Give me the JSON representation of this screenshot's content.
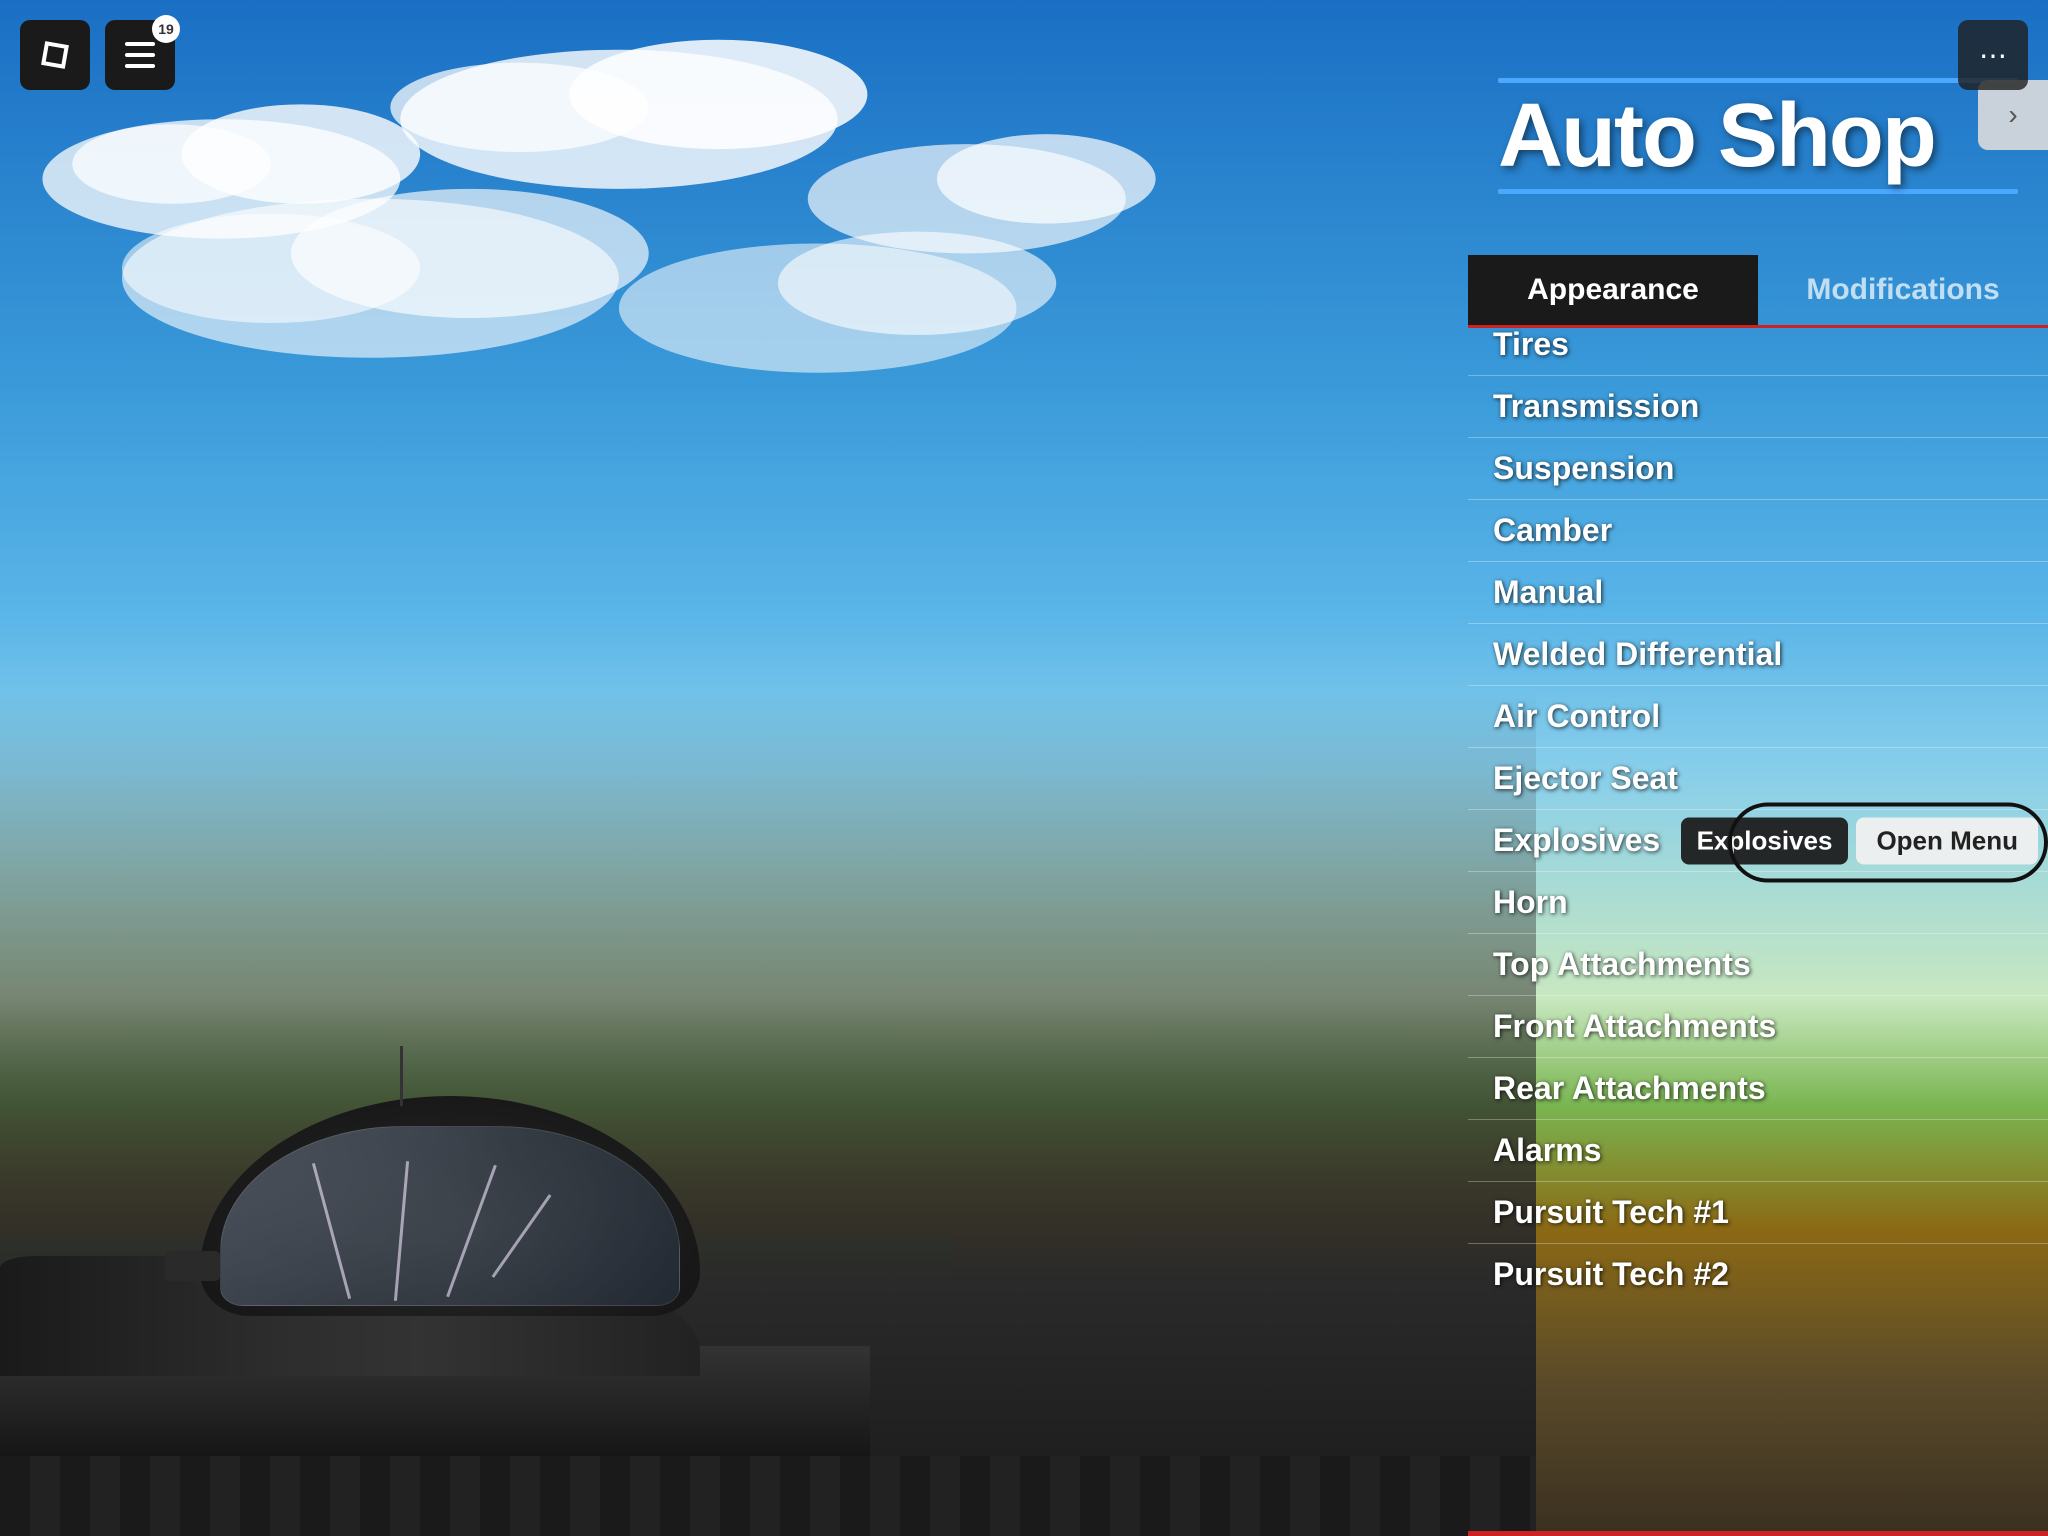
{
  "game": {
    "bg_sky_color_top": "#1a6fc4",
    "bg_sky_color_bottom": "#87ceeb"
  },
  "top_left": {
    "roblox_icon": "✦",
    "notification_icon": "📋",
    "notification_count": "19"
  },
  "top_right": {
    "menu_icon": "⋯"
  },
  "shop": {
    "title": "Auto Shop",
    "title_line_color": "#4aa8ff",
    "nav_arrow": "›",
    "tabs": [
      {
        "label": "Appearance",
        "active": true
      },
      {
        "label": "Modifications",
        "active": false
      }
    ],
    "menu_items": [
      {
        "label": "Tires",
        "partial": true
      },
      {
        "label": "Transmission",
        "partial": false
      },
      {
        "label": "Suspension",
        "partial": false
      },
      {
        "label": "Camber",
        "partial": false
      },
      {
        "label": "Manual",
        "partial": false
      },
      {
        "label": "Welded Differential",
        "partial": false
      },
      {
        "label": "Air Control",
        "partial": false
      },
      {
        "label": "Ejector Seat",
        "partial": false
      },
      {
        "label": "Explosives",
        "partial": false,
        "has_tooltip": true
      },
      {
        "label": "Horn",
        "partial": false
      },
      {
        "label": "Top Attachments",
        "partial": false
      },
      {
        "label": "Front Attachments",
        "partial": false
      },
      {
        "label": "Rear Attachments",
        "partial": false
      },
      {
        "label": "Alarms",
        "partial": false
      },
      {
        "label": "Pursuit Tech #1",
        "partial": false
      },
      {
        "label": "Pursuit Tech #2",
        "partial": false
      }
    ],
    "tooltip": {
      "label": "Explosives",
      "button": "Open Menu"
    },
    "bottom_red_color": "#cc2222"
  }
}
